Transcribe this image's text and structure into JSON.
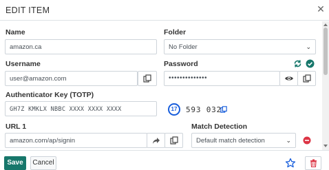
{
  "header": {
    "title": "EDIT ITEM",
    "close_icon": "close-icon"
  },
  "form": {
    "name_label": "Name",
    "name_value": "amazon.ca",
    "folder_label": "Folder",
    "folder_value": "No Folder",
    "username_label": "Username",
    "username_value": "user@amazon.com",
    "password_label": "Password",
    "password_value": "••••••••••••••",
    "totp_label": "Authenticator Key (TOTP)",
    "totp_value": "GH7Z KMKLX NBBC XXXX XXXX XXXX",
    "totp_countdown": "17",
    "totp_code": "593 032",
    "url_label": "URL 1",
    "url_value": "amazon.com/ap/signin",
    "match_label": "Match Detection",
    "match_value": "Default match detection"
  },
  "footer": {
    "save_label": "Save",
    "cancel_label": "Cancel"
  },
  "colors": {
    "save_green": "#17776b",
    "accent_blue": "#175ddc",
    "check_green": "#17776b",
    "remove_red": "#dc3545"
  }
}
